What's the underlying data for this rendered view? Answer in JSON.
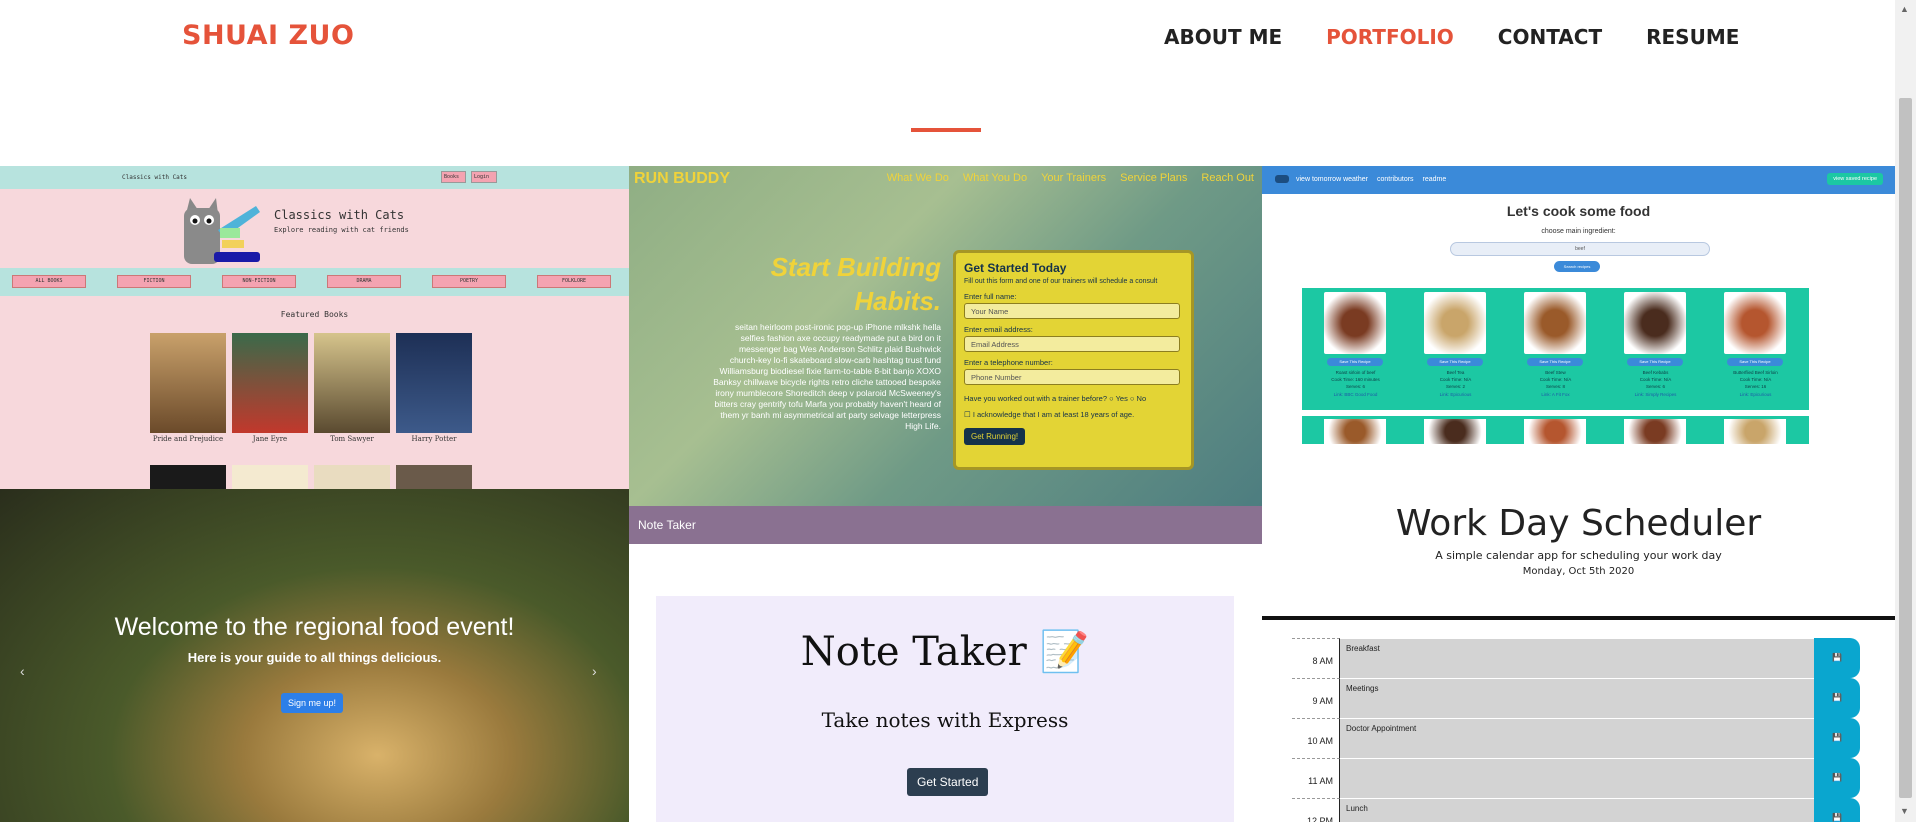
{
  "header": {
    "brand": "SHUAI ZUO",
    "nav": [
      "ABOUT ME",
      "PORTFOLIO",
      "CONTACT",
      "RESUME"
    ],
    "active_nav": "PORTFOLIO",
    "accent": "#e5533a"
  },
  "classics": {
    "top_title": "Classics with Cats",
    "select_label": "Books",
    "login_label": "Login",
    "heading": "Classics with Cats",
    "tagline": "Explore reading with cat friends",
    "categories": [
      "ALL BOOKS",
      "FICTION",
      "NON-FICTION",
      "DRAMA",
      "POETRY",
      "FOLKLORE"
    ],
    "featured_label": "Featured Books",
    "books": [
      "Pride and Prejudice",
      "Jane Eyre",
      "Tom Sawyer",
      "Harry Potter"
    ]
  },
  "runbuddy": {
    "logo": "RUN BUDDY",
    "nav": [
      "What We Do",
      "What You Do",
      "Your Trainers",
      "Service Plans",
      "Reach Out"
    ],
    "headline": "Start Building Habits.",
    "paragraph": "seitan heirloom post-ironic pop-up iPhone mlkshk hella selfies fashion axe occupy readymade put a bird on it messenger bag Wes Anderson Schlitz plaid Bushwick church-key lo-fi skateboard slow-carb hashtag trust fund Williamsburg biodiesel fixie farm-to-table 8-bit banjo XOXO Banksy chillwave bicycle rights retro cliche tattooed bespoke irony mumblecore Shoreditch deep v polaroid McSweeney's bitters cray gentrify tofu Marfa you probably haven't heard of them yr banh mi asymmetrical art party selvage letterpress High Life.",
    "form_title": "Get Started Today",
    "form_subtitle": "Fill out this form and one of our trainers will schedule a consult",
    "name_label": "Enter full name:",
    "name_placeholder": "Your Name",
    "email_label": "Enter email address:",
    "email_placeholder": "Email Address",
    "phone_label": "Enter a telephone number:",
    "phone_placeholder": "Phone Number",
    "trainer_question": "Have you worked out with a trainer before?",
    "yes": "Yes",
    "no": "No",
    "age_ack": "I acknowledge that I am at least 18 years of age.",
    "button": "Get Running!"
  },
  "caption": "Note Taker",
  "recipes": {
    "nav": [
      "view tomorrow weather",
      "contributors",
      "readme"
    ],
    "saved_button": "view saved recipe",
    "heading": "Let's cook some food",
    "prompt": "choose main ingredient:",
    "search_value": "beef",
    "search_button": "Search recipes",
    "cards": [
      {
        "button": "Save This Recipe",
        "name": "Roast sirloin of beef",
        "time": "Cook Time: 160 minutes",
        "serves": "Serves: 6",
        "link": "Link: BBC Good Food"
      },
      {
        "button": "Save This Recipe",
        "name": "Beef Tea",
        "time": "Cook Time: N/A",
        "serves": "Serves: 2",
        "link": "Link: Epicurious"
      },
      {
        "button": "Save This Recipe",
        "name": "Beef Stew",
        "time": "Cook Time: N/A",
        "serves": "Serves: 8",
        "link": "Link: A Fit Fox"
      },
      {
        "button": "Save This Recipe",
        "name": "Beef Kebabs",
        "time": "Cook Time: N/A",
        "serves": "Serves: 6",
        "link": "Link: Simply Recipes"
      },
      {
        "button": "Save This Recipe",
        "name": "Butterflied Beef Sirloin",
        "time": "Cook Time: N/A",
        "serves": "Serves: 16",
        "link": "Link: Epicurious"
      }
    ]
  },
  "scheduler": {
    "title": "Work Day Scheduler",
    "subtitle": "A simple calendar app for scheduling your work day",
    "date": "Monday, Oct 5th 2020",
    "rows": [
      {
        "hour": "8 AM",
        "event": "Breakfast"
      },
      {
        "hour": "9 AM",
        "event": "Meetings"
      },
      {
        "hour": "10 AM",
        "event": "Doctor Appointment"
      },
      {
        "hour": "11 AM",
        "event": ""
      },
      {
        "hour": "12 PM",
        "event": "Lunch"
      }
    ]
  },
  "food": {
    "headline": "Welcome to the regional food event!",
    "subhead": "Here is your guide to all things delicious.",
    "button": "Sign me up!"
  },
  "notetaker": {
    "title": "Note Taker 📝",
    "subtitle": "Take notes with Express",
    "button": "Get Started"
  }
}
